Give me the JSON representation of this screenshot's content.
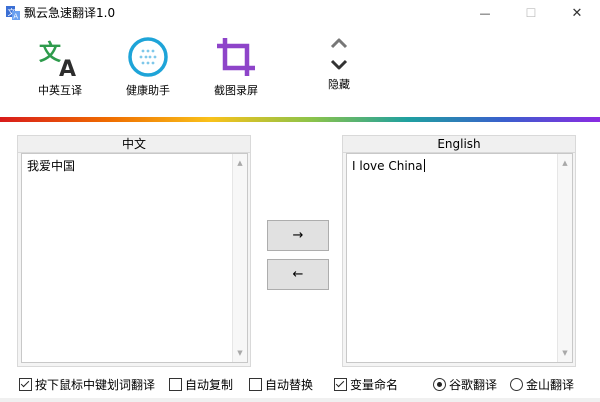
{
  "window": {
    "title": "飘云急速翻译1.0",
    "controls": {
      "minimize": "—",
      "maximize": "☐",
      "close": "✕"
    }
  },
  "toolbar": {
    "items": [
      {
        "label": "中英互译",
        "icon": "translate-icon"
      },
      {
        "label": "健康助手",
        "icon": "health-assistant-icon"
      },
      {
        "label": "截图录屏",
        "icon": "crop-icon"
      },
      {
        "label": "隐藏",
        "icon": "chevron-up-down-icon"
      }
    ]
  },
  "accent_colors": [
    "#d81b1b",
    "#ef6c00",
    "#f9c11a",
    "#8bc34a",
    "#1fa0a0",
    "#3a5fcd",
    "#8a2be2"
  ],
  "source_panel": {
    "header": "中文",
    "text": "我爱中国"
  },
  "target_panel": {
    "header": "English",
    "text": "I love China"
  },
  "buttons": {
    "translate_to_en": "→",
    "translate_to_cn": "←"
  },
  "options": {
    "mouse_middle_translate": {
      "label": "按下鼠标中键划词翻译",
      "checked": true
    },
    "auto_copy": {
      "label": "自动复制",
      "checked": false
    },
    "auto_replace": {
      "label": "自动替换",
      "checked": false
    },
    "variable_naming": {
      "label": "变量命名",
      "checked": true
    },
    "google_translate": {
      "label": "谷歌翻译",
      "selected": true
    },
    "kingsoft_translate": {
      "label": "金山翻译",
      "selected": false
    }
  }
}
